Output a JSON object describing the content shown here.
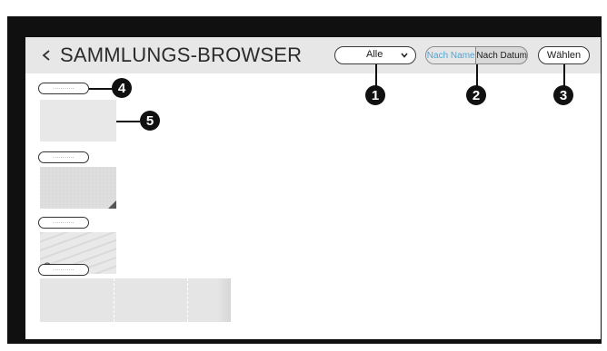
{
  "header": {
    "title": "SAMMLUNGS-BROWSER",
    "back_icon": "chevron-left-icon",
    "filter": {
      "selected": "Alle",
      "icon": "chevron-down-icon"
    },
    "sort": {
      "by_name": "Nach Name",
      "by_date": "Nach Datum",
      "active": "Nach Name",
      "active_color": "#4aa6d8"
    },
    "select_label": "Wählen"
  },
  "callouts": [
    "1",
    "2",
    "3",
    "4",
    "5"
  ],
  "groups": [
    {
      "label": "···········"
    },
    {
      "label": "···········"
    },
    {
      "label": "···········"
    },
    {
      "label": "···········"
    }
  ],
  "colors": {
    "frame": "#101010",
    "header_bg": "#e7e7e7",
    "callout": "#111111"
  }
}
